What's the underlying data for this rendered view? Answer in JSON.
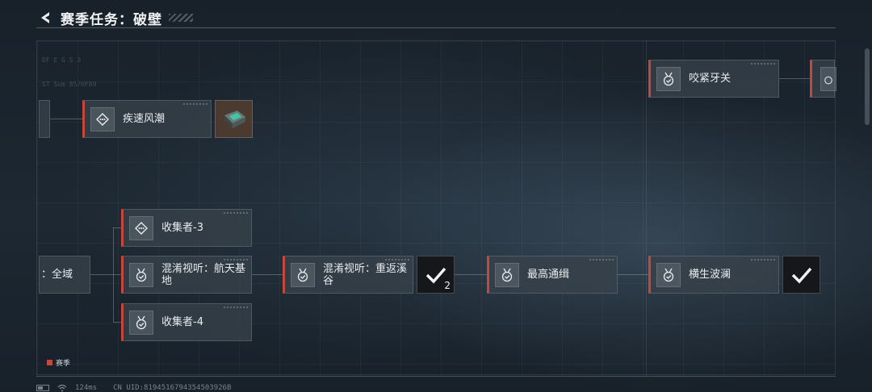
{
  "header": {
    "title": "赛季任务：破壁"
  },
  "nodes": {
    "fast_tide": "疾速风潮",
    "bite_teeth": "咬紧牙关",
    "collector3": "收集者-3",
    "all_area": "：全域",
    "confuse_space": "混淆视听：航天基地",
    "confuse_valley": "混淆视听：重返溪谷",
    "top_wanted": "最高通缉",
    "sudden_wave": "横生波澜",
    "collector4": "收集者-4"
  },
  "rewards": {
    "valley_count": "2"
  },
  "legend": {
    "label": "赛季"
  },
  "footer": {
    "ping": "124ms",
    "uid": "CN UID:8194516794354503926B"
  },
  "deco": {
    "line1": "DF  E G S 3",
    "line2": "ST Sum 85/HF89"
  },
  "colors": {
    "accent": "#c7463a",
    "background": "#1b242d"
  },
  "icons": {
    "back": "back-arrow-icon",
    "diamond": "diamond-route-icon",
    "medal": "medal-check-icon",
    "check": "check-icon",
    "signal": "wifi-icon",
    "battery": "battery-icon"
  }
}
